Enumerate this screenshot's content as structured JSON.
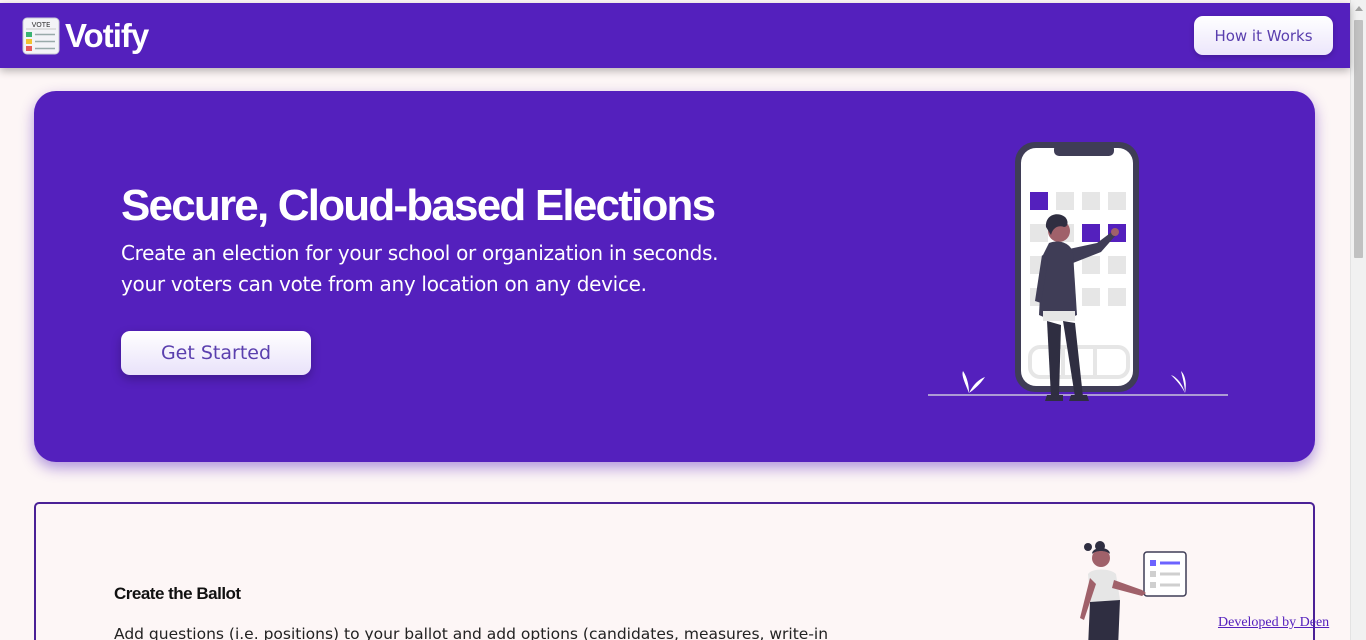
{
  "navbar": {
    "logo_text": "Votify",
    "logo_icon": "ballot-clipboard-icon",
    "logo_icon_label": "VOTE",
    "how_it_works_label": "How it Works"
  },
  "hero": {
    "title": "Secure, Cloud-based Elections",
    "subtitle_line1": "Create an election for your school or organization in seconds.",
    "subtitle_line2": "your voters can vote from any location on any device.",
    "cta_label": "Get Started",
    "illustration": "person-voting-on-phone"
  },
  "ballot_section": {
    "title": "Create the Ballot",
    "description": "Add questions (i.e. positions) to your ballot and add options (candidates, measures, write-in",
    "illustration": "person-with-checklist"
  },
  "footer": {
    "credit_link": "Developed by Deen"
  },
  "colors": {
    "primary": "#5420bd",
    "background": "#fdf6f6",
    "button_text": "#5a3fae",
    "card_border": "#4a2196"
  }
}
